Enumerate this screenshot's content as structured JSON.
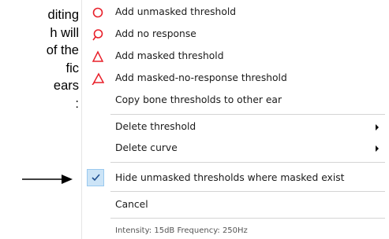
{
  "document": {
    "lines": [
      "diting",
      "h will",
      "of the",
      "fic",
      "ears",
      ":"
    ]
  },
  "menu": {
    "items": [
      {
        "label": "Add unmasked threshold",
        "icon": "red-circle-icon"
      },
      {
        "label": "Add no response",
        "icon": "red-circle-no-response-icon"
      },
      {
        "label": "Add masked threshold",
        "icon": "red-triangle-icon"
      },
      {
        "label": "Add masked-no-response threshold",
        "icon": "red-triangle-no-response-icon"
      },
      {
        "label": "Copy bone thresholds to other ear"
      },
      {
        "label": "Delete threshold",
        "submenu": true
      },
      {
        "label": "Delete curve",
        "submenu": true
      },
      {
        "label": "Hide unmasked thresholds where masked exist",
        "checked": true
      },
      {
        "label": "Cancel"
      }
    ],
    "status": "Intensity: 15dB Frequency: 250Hz"
  },
  "colors": {
    "symbol_red": "#e8202a",
    "check_bg": "#cce4f7",
    "check_border": "#99c9ef",
    "separator": "#d4d4d4"
  }
}
